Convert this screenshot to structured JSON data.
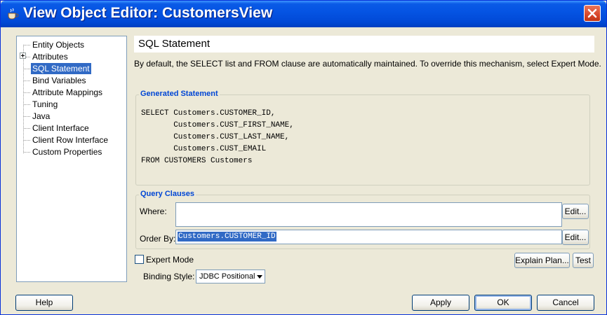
{
  "window": {
    "title": "View Object Editor: CustomersView"
  },
  "nav_tree": {
    "items": [
      {
        "label": "Entity Objects",
        "selected": false,
        "expandable": false
      },
      {
        "label": "Attributes",
        "selected": false,
        "expandable": true
      },
      {
        "label": "SQL Statement",
        "selected": true,
        "expandable": false
      },
      {
        "label": "Bind Variables",
        "selected": false,
        "expandable": false
      },
      {
        "label": "Attribute Mappings",
        "selected": false,
        "expandable": false
      },
      {
        "label": "Tuning",
        "selected": false,
        "expandable": false
      },
      {
        "label": "Java",
        "selected": false,
        "expandable": false
      },
      {
        "label": "Client Interface",
        "selected": false,
        "expandable": false
      },
      {
        "label": "Client Row Interface",
        "selected": false,
        "expandable": false
      },
      {
        "label": "Custom Properties",
        "selected": false,
        "expandable": false
      }
    ]
  },
  "panel": {
    "title": "SQL Statement",
    "description": "By default, the SELECT list and FROM clause are automatically maintained.  To override this mechanism, select Expert Mode."
  },
  "generated_statement": {
    "legend": "Generated Statement",
    "sql_text": "SELECT Customers.CUSTOMER_ID,\n       Customers.CUST_FIRST_NAME,\n       Customers.CUST_LAST_NAME,\n       Customers.CUST_EMAIL\nFROM CUSTOMERS Customers"
  },
  "query_clauses": {
    "legend": "Query Clauses",
    "where_label": "Where:",
    "where_value": "",
    "where_edit": "Edit...",
    "order_by_label": "Order By:",
    "order_by_value": "Customers.CUSTOMER_ID",
    "order_by_edit": "Edit..."
  },
  "expert_mode": {
    "label": "Expert Mode",
    "checked": false
  },
  "binding_style": {
    "label": "Binding Style:",
    "value": "JDBC Positional"
  },
  "buttons": {
    "explain_plan": "Explain Plan...",
    "test": "Test",
    "help": "Help",
    "apply": "Apply",
    "ok": "OK",
    "cancel": "Cancel"
  },
  "colors": {
    "title_bar": "#0554e3",
    "selection": "#316ac5",
    "group_legend": "#0046d5",
    "dialog_bg": "#ece9d8",
    "close_button": "#d8472a"
  },
  "icons": {
    "title": "coffee-cup-icon",
    "close": "close-x-icon"
  }
}
